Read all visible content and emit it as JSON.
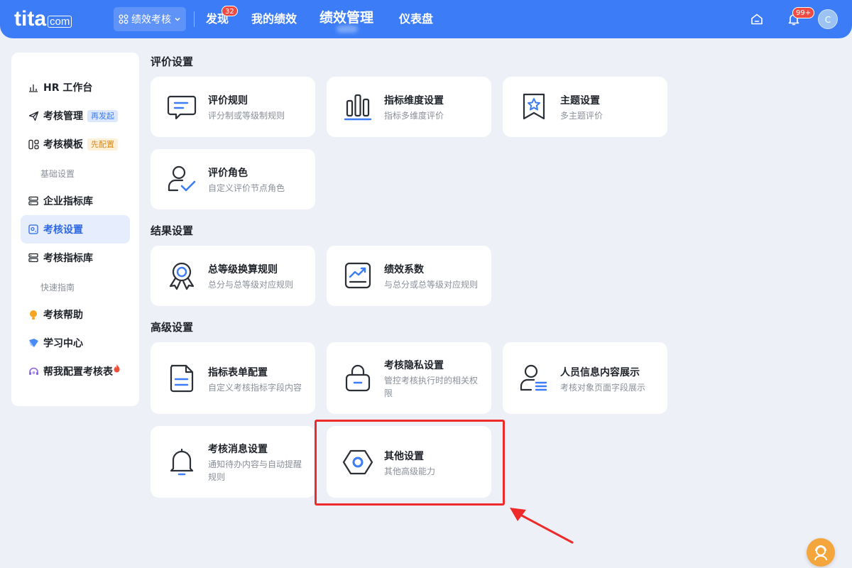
{
  "topbar": {
    "logo_main": "tita",
    "logo_suffix": "com",
    "module_switch_label": "绩效考核",
    "nav": {
      "discover": "发现",
      "discover_badge": "32",
      "my_performance": "我的绩效",
      "performance_management": "绩效管理",
      "dashboard": "仪表盘"
    },
    "notification_badge": "99+",
    "avatar_initial": "C"
  },
  "sidebar": {
    "hr_workbench": "HR 工作台",
    "review_management": "考核管理",
    "review_management_tag": "再发起",
    "review_template": "考核模板",
    "review_template_tag": "先配置",
    "group_basic": "基础设置",
    "enterprise_indicator_library": "企业指标库",
    "review_settings": "考核设置",
    "review_indicator_library": "考核指标库",
    "group_quick_guide": "快速指南",
    "review_help": "考核帮助",
    "learning_center": "学习中心",
    "configure_form_for_me": "帮我配置考核表"
  },
  "sections": {
    "evaluation": "评价设置",
    "result": "结果设置",
    "advanced": "高级设置"
  },
  "cards": {
    "evaluation_rules": {
      "title": "评价规则",
      "desc": "评分制或等级制规则"
    },
    "indicator_dimensions": {
      "title": "指标维度设置",
      "desc": "指标多维度评价"
    },
    "theme": {
      "title": "主题设置",
      "desc": "多主题评价"
    },
    "evaluation_roles": {
      "title": "评价角色",
      "desc": "自定义评价节点角色"
    },
    "grade_conversion": {
      "title": "总等级换算规则",
      "desc": "总分与总等级对应规则"
    },
    "performance_coefficient": {
      "title": "绩效系数",
      "desc": "与总分或总等级对应规则"
    },
    "indicator_form": {
      "title": "指标表单配置",
      "desc": "自定义考核指标字段内容"
    },
    "privacy": {
      "title": "考核隐私设置",
      "desc": "管控考核执行时的相关权限"
    },
    "personnel_info": {
      "title": "人员信息内容展示",
      "desc": "考核对象页面字段展示"
    },
    "message": {
      "title": "考核消息设置",
      "desc": "通知待办内容与自动提醒规则"
    },
    "other": {
      "title": "其他设置",
      "desc": "其他高级能力"
    }
  },
  "colors": {
    "primary": "#3c7cf6",
    "highlight_annotation": "#ee2a2a",
    "badge_red": "#f04b42",
    "help_orange": "#f4a53b"
  }
}
